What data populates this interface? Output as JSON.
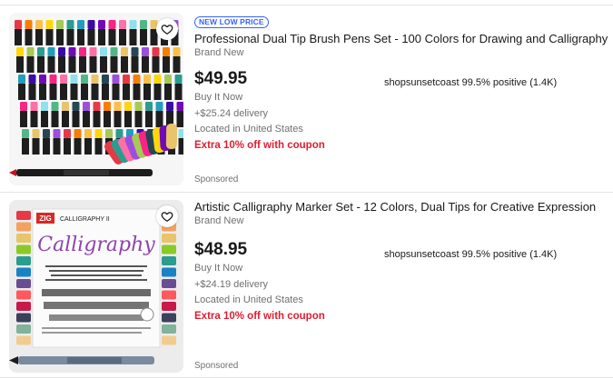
{
  "listings": [
    {
      "badge": "NEW LOW PRICE",
      "title": "Professional Dual Tip Brush Pens Set - 100 Colors for Drawing and Calligraphy",
      "condition": "Brand New",
      "price": "$49.95",
      "format": "Buy It Now",
      "shipping": "+$25.24 delivery",
      "location": "Located in United States",
      "coupon": "Extra 10% off with coupon",
      "seller": "shopsunsetcoast 99.5% positive (1.4K)",
      "sponsored": "Sponsored",
      "pen_colors": [
        "#e63946",
        "#f77f00",
        "#fcbf49",
        "#ffd60a",
        "#a7c957",
        "#2a9d8f",
        "#219ebc",
        "#3a0ca3",
        "#7209b7",
        "#f72585",
        "#ff70a6",
        "#90e0ef",
        "#52b788",
        "#e9c46a",
        "#264653",
        "#9d4edd"
      ]
    },
    {
      "badge": "",
      "title": "Artistic Calligraphy Marker Set - 12 Colors, Dual Tips for Creative Expression",
      "condition": "Brand New",
      "price": "$48.95",
      "format": "Buy It Now",
      "shipping": "+$24.19 delivery",
      "location": "Located in United States",
      "coupon": "Extra 10% off with coupon",
      "seller": "shopsunsetcoast 99.5% positive (1.4K)",
      "sponsored": "Sponsored",
      "product_brand": "ZIG",
      "product_line": "CALLIGRAPHY II",
      "product_script": "Calligraphy",
      "pen_colors": [
        "#e63946",
        "#f4a261",
        "#e9c46a",
        "#8ac926",
        "#2a9d8f",
        "#1982c4",
        "#6a4c93",
        "#ff595e",
        "#c9184a",
        "#3d405b",
        "#81b29a",
        "#f2cc8f"
      ]
    }
  ],
  "icons": {
    "wishlist": "heart-outline-icon"
  }
}
